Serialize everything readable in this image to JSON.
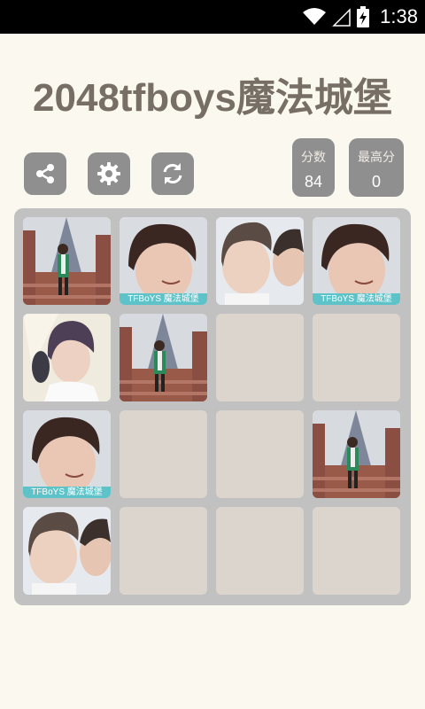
{
  "status_bar": {
    "time": "1:38",
    "icons": [
      "wifi-icon",
      "signal-icon",
      "battery-charging-icon"
    ]
  },
  "app": {
    "title": "2048tfboys魔法城堡"
  },
  "toolbar": {
    "buttons": [
      {
        "id": "share",
        "icon": "share-icon"
      },
      {
        "id": "settings",
        "icon": "gear-icon"
      },
      {
        "id": "restart",
        "icon": "refresh-icon"
      }
    ],
    "score_label": "分数",
    "score_value": "84",
    "best_label": "最高分",
    "best_value": "0"
  },
  "board": {
    "size": 4,
    "rows": [
      [
        "castle-boy",
        "boy-smile-watermark",
        "two-boys",
        "boy-smile-watermark"
      ],
      [
        "boy-purple-hair",
        "castle-boy",
        "empty",
        "empty"
      ],
      [
        "boy-smile-watermark",
        "empty",
        "empty",
        "castle-boy"
      ],
      [
        "two-boys",
        "empty",
        "empty",
        "empty"
      ]
    ],
    "watermark_text": "TFBoYS 魔法城堡"
  },
  "colors": {
    "background": "#faf8ef",
    "title": "#776e65",
    "button": "#8f8f8f",
    "board": "#c2c1c1",
    "empty_cell": "#dcd5ce",
    "watermark": "#5ec3c9"
  }
}
